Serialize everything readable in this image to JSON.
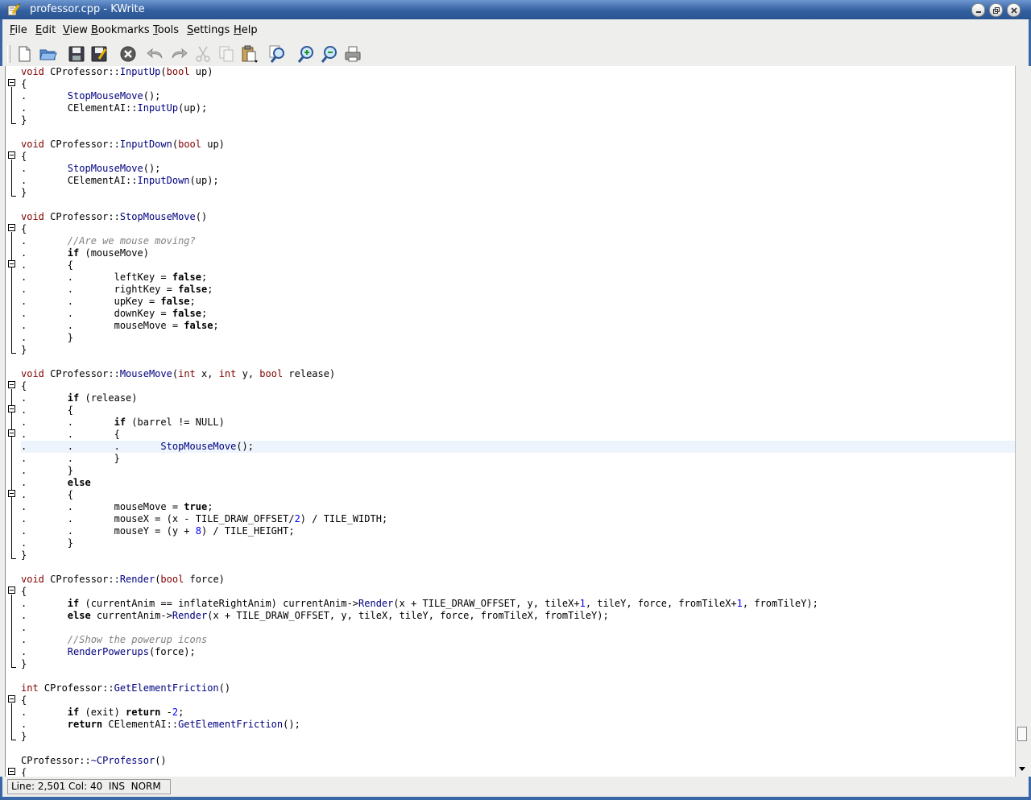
{
  "window": {
    "title": "professor.cpp - KWrite"
  },
  "menubar": {
    "items": [
      {
        "accel": "F",
        "rest": "ile"
      },
      {
        "accel": "E",
        "rest": "dit"
      },
      {
        "accel": "V",
        "rest": "iew"
      },
      {
        "accel": "B",
        "rest": "ookmarks"
      },
      {
        "accel": "T",
        "rest": "ools"
      },
      {
        "accel": "S",
        "rest": "ettings"
      },
      {
        "accel": "H",
        "rest": "elp"
      }
    ]
  },
  "toolbar": {
    "icons": [
      "new-document-icon",
      "open-folder-icon",
      "save-icon",
      "save-as-icon",
      "close-document-icon",
      "undo-icon",
      "redo-icon",
      "cut-icon",
      "copy-icon",
      "paste-icon",
      "find-icon",
      "zoom-in-icon",
      "zoom-out-icon",
      "print-icon"
    ]
  },
  "editor": {
    "current_line_index": 31,
    "lines": [
      "void CProfessor::InputUp(bool up)",
      "{",
      ".       StopMouseMove();",
      ".       CElementAI::InputUp(up);",
      "}",
      "",
      "void CProfessor::InputDown(bool up)",
      "{",
      ".       StopMouseMove();",
      ".       CElementAI::InputDown(up);",
      "}",
      "",
      "void CProfessor::StopMouseMove()",
      "{",
      ".       //Are we mouse moving?",
      ".       if (mouseMove)",
      ".       {",
      ".       .       leftKey = false;",
      ".       .       rightKey = false;",
      ".       .       upKey = false;",
      ".       .       downKey = false;",
      ".       .       mouseMove = false;",
      ".       }",
      "}",
      "",
      "void CProfessor::MouseMove(int x, int y, bool release)",
      "{",
      ".       if (release)",
      ".       {",
      ".       .       if (barrel != NULL)",
      ".       .       {",
      ".       .       .       StopMouseMove();",
      ".       .       }",
      ".       }",
      ".       else",
      ".       {",
      ".       .       mouseMove = true;",
      ".       .       mouseX = (x - TILE_DRAW_OFFSET/2) / TILE_WIDTH;",
      ".       .       mouseY = (y + 8) / TILE_HEIGHT;",
      ".       }",
      "}",
      "",
      "void CProfessor::Render(bool force)",
      "{",
      ".       if (currentAnim == inflateRightAnim) currentAnim->Render(x + TILE_DRAW_OFFSET, y, tileX+1, tileY, force, fromTileX+1, fromTileY);",
      ".       else currentAnim->Render(x + TILE_DRAW_OFFSET, y, tileX, tileY, force, fromTileX, fromTileY);",
      ".",
      ".       //Show the powerup icons",
      ".       RenderPowerups(force);",
      "}",
      "",
      "int CProfessor::GetElementFriction()",
      "{",
      ".       if (exit) return -2;",
      ".       return CElementAI::GetElementFriction();",
      "}",
      "",
      "CProfessor::~CProfessor()",
      "{"
    ]
  },
  "statusbar": {
    "text": "Line: 2,501 Col: 40  INS  NORM"
  },
  "colors": {
    "titlebar": "#33609f",
    "keyword": "#000000",
    "type": "#800000",
    "function": "#000080",
    "comment": "#808080",
    "number": "#0000ff"
  }
}
